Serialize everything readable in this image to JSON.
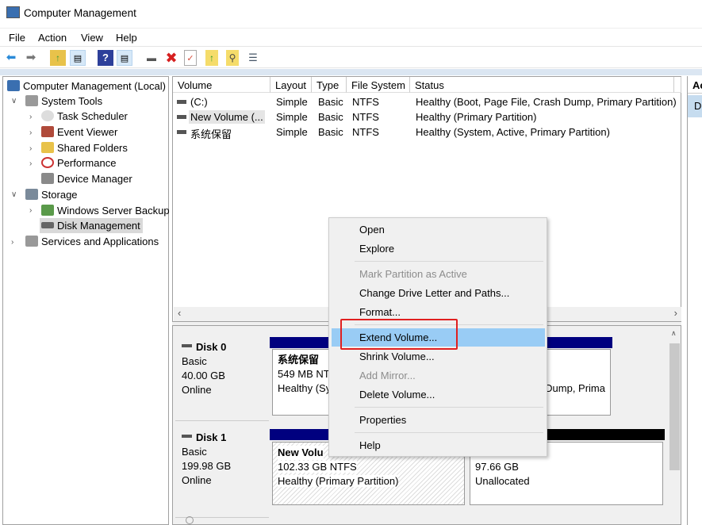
{
  "window": {
    "title": "Computer Management"
  },
  "menu": [
    "File",
    "Action",
    "View",
    "Help"
  ],
  "toolbar": [
    "back-icon",
    "forward-icon",
    "up-folder-icon",
    "show-hide-tree-icon",
    "help-icon",
    "show-hide-action-icon",
    "connect-icon",
    "delete-icon",
    "properties-icon",
    "import-icon",
    "search-icon",
    "list-icon"
  ],
  "tree": {
    "root": "Computer Management (Local)",
    "system_tools": "System Tools",
    "task_scheduler": "Task Scheduler",
    "event_viewer": "Event Viewer",
    "shared_folders": "Shared Folders",
    "performance": "Performance",
    "device_manager": "Device Manager",
    "storage": "Storage",
    "wsb": "Windows Server Backup",
    "disk_management": "Disk Management",
    "services": "Services and Applications"
  },
  "volumes": {
    "columns": [
      "Volume",
      "Layout",
      "Type",
      "File System",
      "Status"
    ],
    "rows": [
      [
        "(C:)",
        "Simple",
        "Basic",
        "NTFS",
        "Healthy (Boot, Page File, Crash Dump, Primary Partition)"
      ],
      [
        "New Volume (...",
        "Simple",
        "Basic",
        "NTFS",
        "Healthy (Primary Partition)"
      ],
      [
        "系统保留",
        "Simple",
        "Basic",
        "NTFS",
        "Healthy (System, Active, Primary Partition)"
      ]
    ]
  },
  "disks": [
    {
      "name": "Disk 0",
      "type": "Basic",
      "size": "40.00 GB",
      "status": "Online",
      "p1": {
        "name": "系统保留",
        "size": "549 MB NT",
        "status": "Healthy (Sy"
      },
      "p2": {
        "status": "Dump, Prima"
      }
    },
    {
      "name": "Disk 1",
      "type": "Basic",
      "size": "199.98 GB",
      "status": "Online",
      "p1": {
        "name": "New Volu",
        "size": "102.33 GB NTFS",
        "status": "Healthy (Primary Partition)"
      },
      "p2": {
        "size": "97.66 GB",
        "status": "Unallocated"
      }
    }
  ],
  "actions": {
    "header": "Ac",
    "item": "D"
  },
  "context_menu": {
    "items": [
      {
        "label": "Open",
        "enabled": true
      },
      {
        "label": "Explore",
        "enabled": true
      },
      {
        "label": "Mark Partition as Active",
        "enabled": false
      },
      {
        "label": "Change Drive Letter and Paths...",
        "enabled": true
      },
      {
        "label": "Format...",
        "enabled": true
      },
      {
        "label": "Extend Volume...",
        "enabled": true,
        "highlighted": true
      },
      {
        "label": "Shrink Volume...",
        "enabled": true
      },
      {
        "label": "Add Mirror...",
        "enabled": false
      },
      {
        "label": "Delete Volume...",
        "enabled": true
      },
      {
        "label": "Properties",
        "enabled": true
      },
      {
        "label": "Help",
        "enabled": true
      }
    ]
  },
  "colors": {
    "primary_partition_bar": "#00007f",
    "unallocated_bar": "#000000",
    "highlight": "#99ccf5",
    "annotation": "#e02020"
  }
}
